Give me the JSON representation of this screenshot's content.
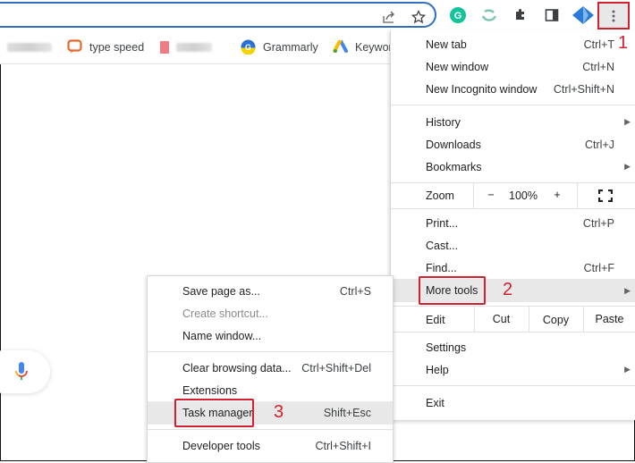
{
  "toolbar": {
    "icons": [
      "share-icon",
      "star-icon",
      "grammarly-extension-icon",
      "extension-swirl-icon",
      "extensions-puzzle-icon",
      "side-panel-icon",
      "extension-diamond-icon",
      "more-vert-icon"
    ],
    "menu_button_annotation": "1"
  },
  "bookmarks": [
    {
      "label": "",
      "icon": "blurred-bookmark-icon",
      "blurred": true
    },
    {
      "label": "type speed",
      "icon": "chat-bubble-icon"
    },
    {
      "label": "",
      "icon": "red-bookmark-icon",
      "blurred": true
    },
    {
      "label": "Grammarly",
      "icon": "grammarly-icon"
    },
    {
      "label": "Keywor",
      "icon": "google-ads-icon"
    }
  ],
  "main_menu": {
    "items": [
      {
        "label": "New tab",
        "shortcut": "Ctrl+T"
      },
      {
        "label": "New window",
        "shortcut": "Ctrl+N"
      },
      {
        "label": "New Incognito window",
        "shortcut": "Ctrl+Shift+N"
      },
      {
        "label": "History",
        "shortcut": "",
        "submenu": true
      },
      {
        "label": "Downloads",
        "shortcut": "Ctrl+J"
      },
      {
        "label": "Bookmarks",
        "shortcut": "",
        "submenu": true
      },
      {
        "label": "Print...",
        "shortcut": "Ctrl+P"
      },
      {
        "label": "Cast...",
        "shortcut": ""
      },
      {
        "label": "Find...",
        "shortcut": "Ctrl+F"
      },
      {
        "label": "More tools",
        "shortcut": "",
        "submenu": true,
        "highlighted": true,
        "annotation": "2"
      },
      {
        "label": "Settings",
        "shortcut": ""
      },
      {
        "label": "Help",
        "shortcut": "",
        "submenu": true
      },
      {
        "label": "Exit",
        "shortcut": ""
      }
    ],
    "zoom": {
      "label": "Zoom",
      "minus": "−",
      "value": "100%",
      "plus": "+"
    },
    "edit": {
      "label": "Edit",
      "cut": "Cut",
      "copy": "Copy",
      "paste": "Paste"
    }
  },
  "more_tools_menu": {
    "items": [
      {
        "label": "Save page as...",
        "shortcut": "Ctrl+S"
      },
      {
        "label": "Create shortcut...",
        "shortcut": "",
        "disabled": true
      },
      {
        "label": "Name window...",
        "shortcut": ""
      },
      {
        "label": "Clear browsing data...",
        "shortcut": "Ctrl+Shift+Del"
      },
      {
        "label": "Extensions",
        "shortcut": ""
      },
      {
        "label": "Task manager",
        "shortcut": "Shift+Esc",
        "highlighted": true,
        "annotation": "3"
      },
      {
        "label": "Developer tools",
        "shortcut": "Ctrl+Shift+I"
      }
    ]
  },
  "colors": {
    "annotation_red": "#d3202e",
    "omnibox_border": "#2f6fbf",
    "highlight": "#e8e8e8"
  }
}
